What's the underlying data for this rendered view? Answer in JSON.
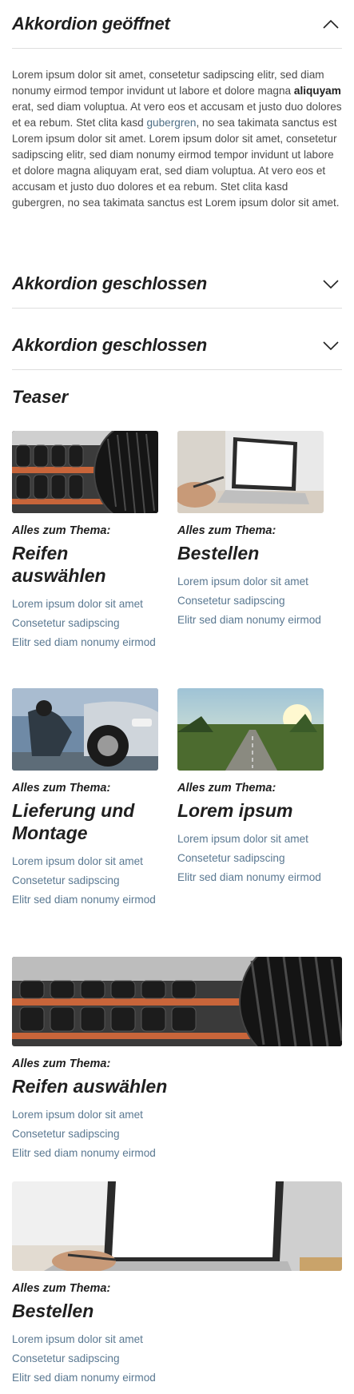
{
  "accordion": [
    {
      "title": "Akkordion geöffnet",
      "state": "open",
      "icon": "chevron-up-icon",
      "body": {
        "p1": "Lorem ipsum dolor sit amet, consetetur sadipscing elitr, sed diam nonumy eirmod tempor invidunt ut labore et dolore magna ",
        "bold": "aliquyam",
        "p2": " erat, sed diam voluptua. At vero eos et accusam et justo duo dolores et ea rebum. Stet clita kasd ",
        "link": "gubergren",
        "p3": ", no sea takimata sanctus est Lorem ipsum dolor sit amet. Lorem ipsum dolor sit amet, consetetur sadipscing elitr, sed diam nonumy eirmod tempor invidunt ut labore et dolore magna aliquyam erat, sed diam voluptua. At vero eos et accusam et justo duo dolores et ea rebum. Stet clita kasd gubergren, no sea takimata sanctus est Lorem ipsum dolor sit amet."
      }
    },
    {
      "title": "Akkordion geschlossen",
      "state": "closed",
      "icon": "chevron-down-icon"
    },
    {
      "title": "Akkordion geschlossen",
      "state": "closed",
      "icon": "chevron-down-icon"
    }
  ],
  "teaser_section": {
    "title": "Teaser",
    "cards": [
      {
        "kicker": "Alles zum Thema:",
        "title": "Reifen auswählen",
        "image": "tyres-on-shelf-image",
        "links": [
          "Lorem ipsum dolor sit amet",
          "Consetetur sadipscing",
          "Elitr sed diam nonumy eirmod"
        ]
      },
      {
        "kicker": "Alles zum Thema:",
        "title": "Bestellen",
        "image": "laptop-image",
        "links": [
          "Lorem ipsum dolor sit amet",
          "Consetetur sadipscing",
          "Elitr sed diam nonumy eirmod"
        ]
      },
      {
        "kicker": "Alles zum Thema:",
        "title": "Lieferung und Montage",
        "image": "mechanic-changing-tyre-image",
        "links": [
          "Lorem ipsum dolor sit amet",
          "Consetetur sadipscing",
          "Elitr sed diam nonumy eirmod"
        ]
      },
      {
        "kicker": "Alles zum Thema:",
        "title": "Lorem ipsum",
        "image": "road-landscape-image",
        "links": [
          "Lorem ipsum dolor sit amet",
          "Consetetur sadipscing",
          "Elitr sed diam nonumy eirmod"
        ]
      },
      {
        "kicker": "Alles zum Thema:",
        "title": "Reifen auswählen",
        "image": "tyres-wide-image",
        "links": [
          "Lorem ipsum dolor sit amet",
          "Consetetur sadipscing",
          "Elitr sed diam nonumy eirmod"
        ]
      },
      {
        "kicker": "Alles zum Thema:",
        "title": "Bestellen",
        "image": "laptop-wide-image",
        "links": [
          "Lorem ipsum dolor sit amet",
          "Consetetur sadipscing",
          "Elitr sed diam nonumy eirmod"
        ]
      }
    ]
  },
  "colors": {
    "text": "#1f1f1f",
    "body_text": "#4a4a4a",
    "link": "#5a7891",
    "divider": "#dedede"
  }
}
